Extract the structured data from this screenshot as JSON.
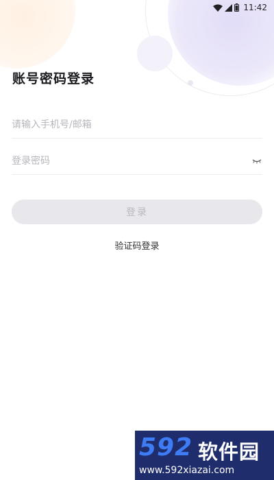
{
  "status_bar": {
    "time": "11:42",
    "icons": [
      "wifi-icon",
      "cell-signal-icon",
      "battery-icon"
    ]
  },
  "login": {
    "title": "账号密码登录",
    "phone_placeholder": "请输入手机号/邮箱",
    "password_placeholder": "登录密码",
    "password_toggle_icon": "eye-closed-icon",
    "submit_label": "登录",
    "sms_login_label": "验证码登录"
  },
  "watermark": {
    "logo_text": "592",
    "name": "软件园",
    "url": "www.592xiazai.com"
  },
  "colors": {
    "button_disabled_bg": "#e7e7ec",
    "button_disabled_text": "#b8b8c0",
    "watermark_bg": "#202d6d",
    "watermark_accent": "#3e7cf5"
  }
}
